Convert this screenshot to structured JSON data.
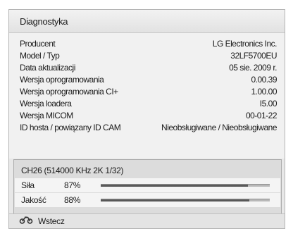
{
  "dialog": {
    "title": "Diagnostyka"
  },
  "info": [
    {
      "label": "Producent",
      "value": "LG Electronics Inc."
    },
    {
      "label": "Model / Typ",
      "value": "32LF5700EU"
    },
    {
      "label": "Data aktualizacji",
      "value": "05 sie. 2009 r."
    },
    {
      "label": "Wersja oprogramowania",
      "value": "0.00.39"
    },
    {
      "label": "Wersja oprogramowania CI+",
      "value": "1.00.00"
    },
    {
      "label": "Wersja loadera",
      "value": "I5.00"
    },
    {
      "label": "Wersja MICOM",
      "value": "00-01-22"
    },
    {
      "label": "ID hosta / powiązany ID CAM",
      "value": "Nieobsługiwane / Nieobsługiwane"
    }
  ],
  "signal": {
    "channel": "CH26 (514000 KHz 2K 1/32)",
    "strength": {
      "label": "Siła",
      "percent": "87%",
      "level": 0.87
    },
    "quality": {
      "label": "Jakość",
      "percent": "88%",
      "level": 0.88
    }
  },
  "footer": {
    "back_label": "Wstecz",
    "back_icon": "return-arrow-icon"
  }
}
